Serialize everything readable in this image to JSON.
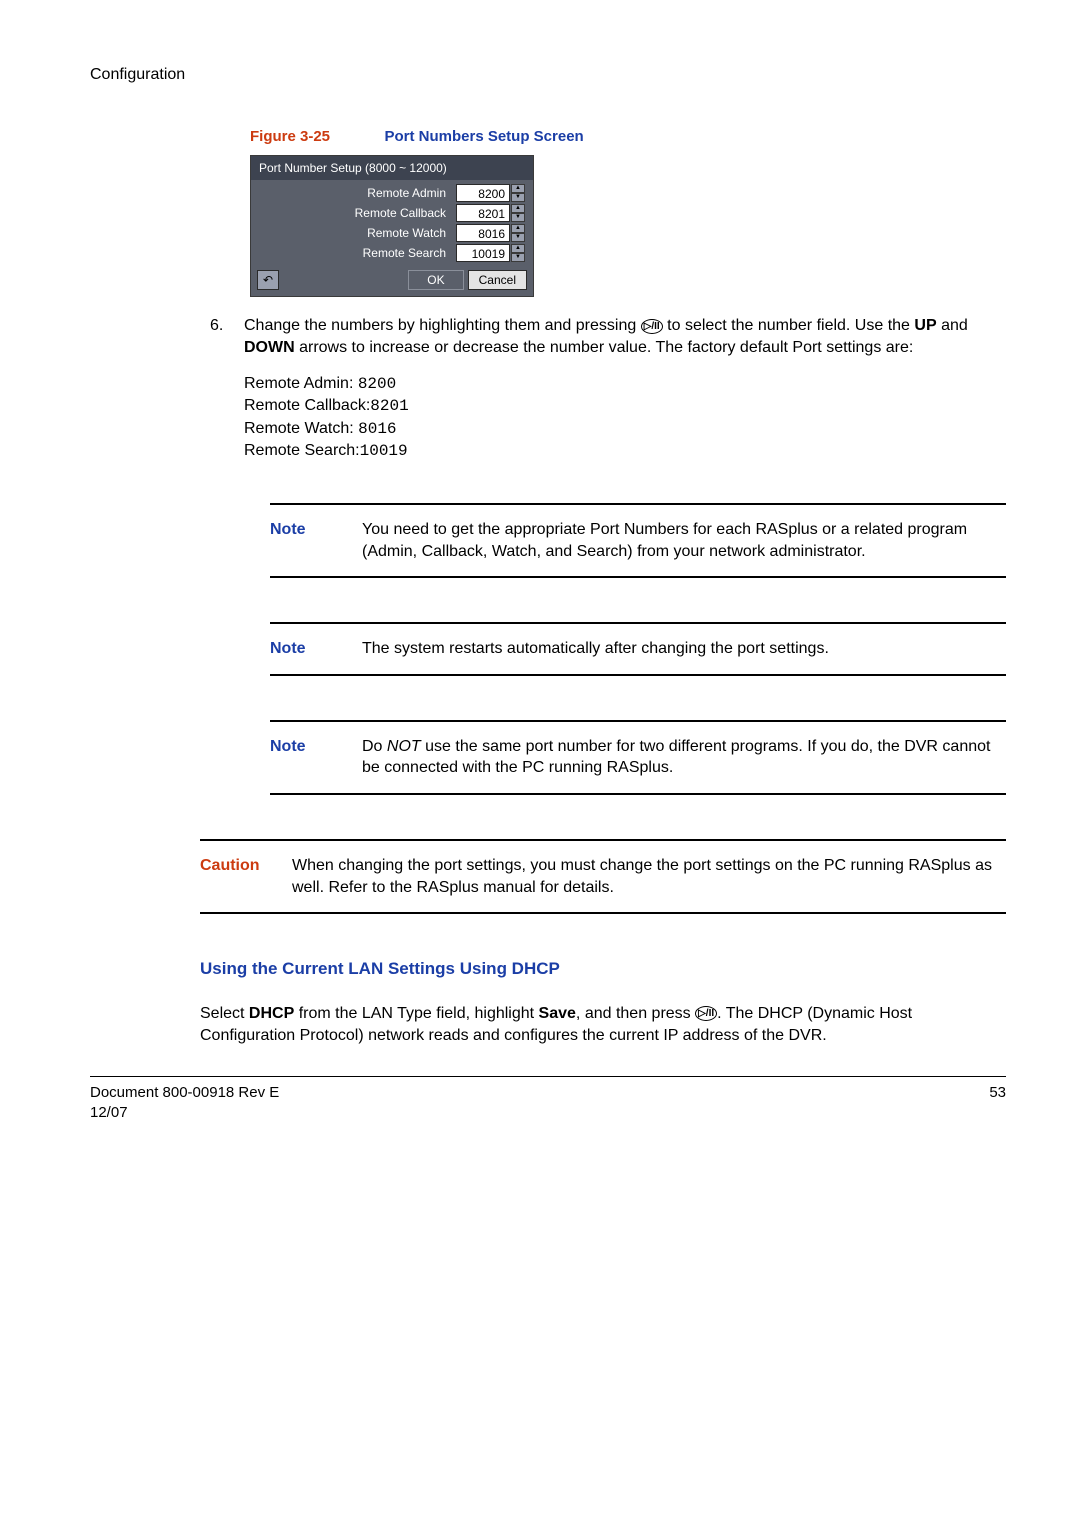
{
  "header": {
    "section": "Configuration"
  },
  "figure": {
    "label": "Figure 3-25",
    "title": "Port Numbers Setup Screen"
  },
  "dialog": {
    "title": "Port Number Setup (8000 ~ 12000)",
    "rows": [
      {
        "label": "Remote Admin",
        "value": "8200"
      },
      {
        "label": "Remote Callback",
        "value": "8201"
      },
      {
        "label": "Remote Watch",
        "value": "8016"
      },
      {
        "label": "Remote Search",
        "value": "10019"
      }
    ],
    "ok": "OK",
    "cancel": "Cancel",
    "back": "↶"
  },
  "step6": {
    "num": "6.",
    "line1a": "Change the numbers by highlighting them and pressing ",
    "line1b": " to select the number field. Use the ",
    "up": "UP",
    "and": " and ",
    "down": "DOWN",
    "line1c": " arrows to increase or decrease the number value. The factory default Port settings are:"
  },
  "defaults": {
    "l1a": "Remote Admin: ",
    "l1b": "8200",
    "l2a": "Remote Callback:",
    "l2b": "8201",
    "l3a": "Remote Watch: ",
    "l3b": "8016",
    "l4a": "Remote Search:",
    "l4b": "10019"
  },
  "notes": {
    "label": "Note",
    "n1": "You need to get the appropriate Port Numbers for each RASplus or a related program (Admin, Callback, Watch, and Search) from your network administrator.",
    "n2": "The system restarts automatically after changing the port settings.",
    "n3a": "Do ",
    "n3not": "NOT",
    "n3b": " use the same port number for two different programs. If you do, the DVR cannot be connected with the PC running RASplus."
  },
  "caution": {
    "label": "Caution",
    "text": "When changing the port settings, you must change the port settings on the PC running RASplus as well. Refer to the RASplus manual for details."
  },
  "dhcp": {
    "heading": "Using the Current LAN Settings Using DHCP",
    "p1a": "Select ",
    "dhcp": "DHCP",
    "p1b": " from the LAN Type field, highlight ",
    "save": "Save",
    "p1c": ", and then press ",
    "p1d": ". The DHCP (Dynamic Host Configuration Protocol) network reads and configures the current IP address of the DVR."
  },
  "footer": {
    "doc": "Document 800-00918 Rev E",
    "date": "12/07",
    "page": "53"
  },
  "icon": {
    "enter": "▷/II"
  }
}
